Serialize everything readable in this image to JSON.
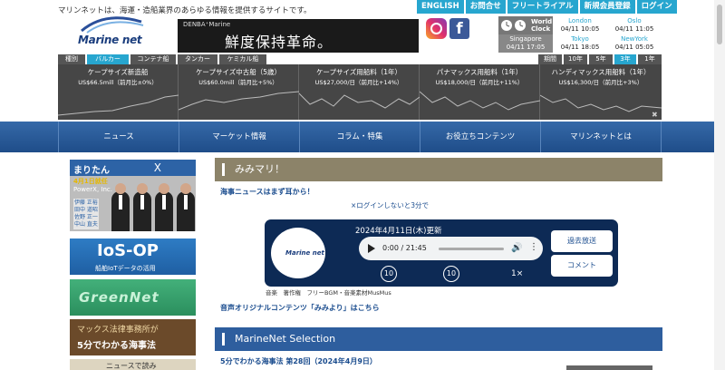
{
  "header": {
    "tagline": "マリンネットは、海運・造船業界のあらゆる情報を提供するサイトです。",
    "logo_text": "Marine net",
    "topnav": [
      "ENGLISH",
      "お問合せ",
      "フリートライアル",
      "新規会員登録",
      "ログイン"
    ],
    "banner": {
      "sub": "DENBA⁺Marine",
      "main": "鮮度保持革命。"
    },
    "world_clock": {
      "title_line1": "World",
      "title_line2": "Clock",
      "cities": [
        {
          "city": "London",
          "time": "04/11 10:05"
        },
        {
          "city": "Oslo",
          "time": "04/11 11:05"
        },
        {
          "city": "Singapore",
          "time": "04/11 17:05"
        },
        {
          "city": "Tokyo",
          "time": "04/11 18:05"
        },
        {
          "city": "NewYork",
          "time": "04/11 05:05"
        }
      ]
    }
  },
  "market": {
    "type_label": "種別",
    "vessel_tabs": [
      "バルカー",
      "コンテナ船",
      "タンカー",
      "ケミカル船"
    ],
    "active_vessel_tab": "バルカー",
    "period_label": "期間",
    "period_tabs": [
      "10年",
      "5年",
      "3年",
      "1年"
    ],
    "active_period_tab": "3年",
    "cells": [
      {
        "name": "ケープサイズ新造船",
        "price": "US$66.5mill（前月比±0%）"
      },
      {
        "name": "ケープサイズ中古船（5歳）",
        "price": "US$60.0mill（前月比+5%）"
      },
      {
        "name": "ケープサイズ用船料（1年）",
        "price": "US$27,000/日（前月比+14%）"
      },
      {
        "name": "パナマックス用船料（1年）",
        "price": "US$18,000/日（前月比+11%）"
      },
      {
        "name": "ハンディマックス用船料（1年）",
        "price": "US$16,300/日（前月比+3%）"
      }
    ],
    "close_icon": "✖"
  },
  "mainnav": [
    "ニュース",
    "マーケット情報",
    "コラム・特集",
    "お役立ちコンテンツ",
    "マリンネットとは"
  ],
  "sidebar": {
    "banner1": {
      "title": "まりたん",
      "x": "X",
      "line1": "4月1日就任",
      "line2": "PowerX, Inc.",
      "names": [
        "伊藤 正裕",
        "田中 道昭",
        "佐野 正一",
        "中山 直夫"
      ]
    },
    "banner2": {
      "title": "IoS-OP",
      "sub": "船舶IoTデータの活用"
    },
    "banner3": {
      "title": "GreenNet"
    },
    "banner4": {
      "line1": "マックス法律事務所が",
      "line2": "5分でわかる海事法"
    },
    "banner5": {
      "title": "ニュースで読み"
    }
  },
  "main": {
    "section1_title": "みみマリ！",
    "headline": "海事ニュースはまず耳から！",
    "login_msg": "×ログインしないと3分で",
    "player": {
      "logo": "Marine net",
      "date": "2024年4月11日(木)更新",
      "time": "0:00 / 21:45",
      "rewind": "10",
      "forward": "10",
      "speed": "1×",
      "btn_past": "過去放送",
      "btn_comment": "コメント"
    },
    "credit": "音楽　著作権　フリーBGM・音楽素材MusMus",
    "link": "音声オリジナルコンテンツ「みみより」はこちら",
    "section2_title": "MarineNet Selection",
    "article": "5分でわかる海事法 第28回（2024年4月9日）"
  }
}
